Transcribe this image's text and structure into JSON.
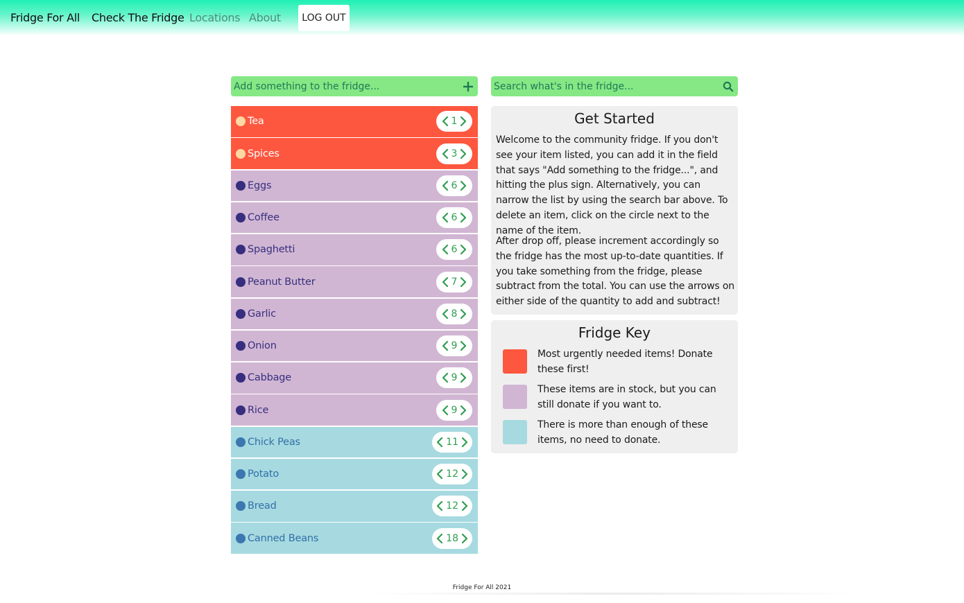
{
  "nav": {
    "brand": "Fridge For All",
    "links": [
      {
        "label": "Check The Fridge",
        "active": true
      },
      {
        "label": "Locations",
        "active": false
      },
      {
        "label": "About",
        "active": false
      }
    ],
    "logout_label": "LOG OUT"
  },
  "add_bar": {
    "placeholder": "Add something to the fridge...",
    "icon": "plus-icon"
  },
  "search_bar": {
    "placeholder": "Search what's in the fridge...",
    "icon": "search-icon"
  },
  "colors": {
    "urgent_bg": "#fe573f",
    "urgent_dot": "#ffd9a3",
    "urgent_text": "#ffffff",
    "stock_bg": "#d1b6d3",
    "stock_dot": "#372e80",
    "stock_text": "#37307f",
    "plenty_bg": "#a6dae0",
    "plenty_dot": "#3b78b0",
    "plenty_text": "#336fa8",
    "accent_green": "#2e9e4f",
    "bar_green": "#85e885"
  },
  "items": [
    {
      "name": "Tea",
      "quantity": 1,
      "status": "urgent"
    },
    {
      "name": "Spices",
      "quantity": 3,
      "status": "urgent"
    },
    {
      "name": "Eggs",
      "quantity": 6,
      "status": "stock"
    },
    {
      "name": "Coffee",
      "quantity": 6,
      "status": "stock"
    },
    {
      "name": "Spaghetti",
      "quantity": 6,
      "status": "stock"
    },
    {
      "name": "Peanut Butter",
      "quantity": 7,
      "status": "stock"
    },
    {
      "name": "Garlic",
      "quantity": 8,
      "status": "stock"
    },
    {
      "name": "Onion",
      "quantity": 9,
      "status": "stock"
    },
    {
      "name": "Cabbage",
      "quantity": 9,
      "status": "stock"
    },
    {
      "name": "Rice",
      "quantity": 9,
      "status": "stock"
    },
    {
      "name": "Chick Peas",
      "quantity": 11,
      "status": "plenty"
    },
    {
      "name": "Potato",
      "quantity": 12,
      "status": "plenty"
    },
    {
      "name": "Bread",
      "quantity": 12,
      "status": "plenty"
    },
    {
      "name": "Canned Beans",
      "quantity": 18,
      "status": "plenty"
    }
  ],
  "get_started": {
    "title": "Get Started",
    "paragraphs": [
      "Welcome to the community fridge. If you don't see your item listed, you can add it in the field that says \"Add something to the fridge...\", and hitting the plus sign. Alternatively, you can narrow the list by using the search bar above. To delete an item, click on the circle next to the name of the item.",
      "After drop off, please increment accordingly so the fridge has the most up-to-date quantities. If you take something from the fridge, please subtract from the total. You can use the arrows on either side of the quantity to add and subtract!"
    ]
  },
  "fridge_key": {
    "title": "Fridge Key",
    "entries": [
      {
        "status": "urgent",
        "text": "Most urgently needed items! Donate these first!"
      },
      {
        "status": "stock",
        "text": "These items are in stock, but you can still donate if you want to."
      },
      {
        "status": "plenty",
        "text": "There is more than enough of these items, no need to donate."
      }
    ]
  },
  "footer": {
    "text": "Fridge For All 2021"
  }
}
